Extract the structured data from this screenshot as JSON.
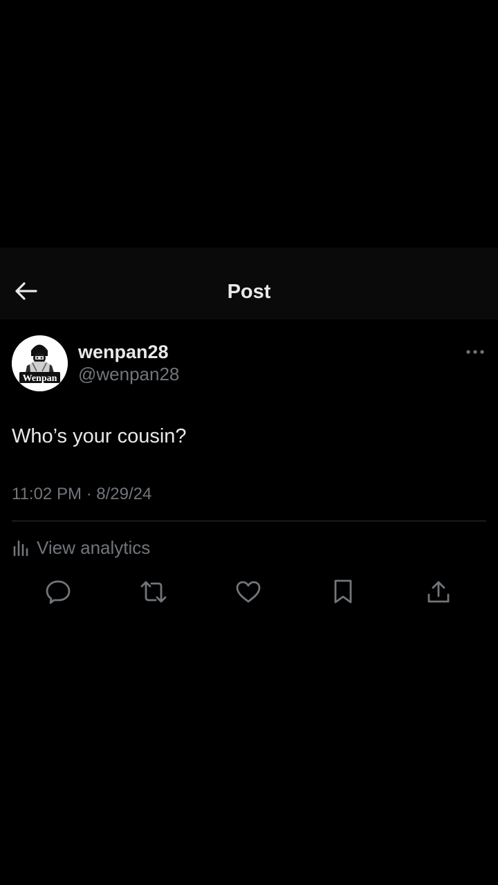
{
  "header": {
    "title": "Post",
    "back_icon": "arrow-left-icon"
  },
  "author": {
    "display_name": "wenpan28",
    "handle": "@wenpan28",
    "avatar_text": "Wenpan"
  },
  "post": {
    "text": "Who’s your cousin?",
    "timestamp": "11:02 PM · 8/29/24"
  },
  "analytics": {
    "label": "View analytics",
    "icon": "bar-chart-icon"
  },
  "actions": [
    {
      "name": "reply",
      "icon": "speech-bubble-icon"
    },
    {
      "name": "repost",
      "icon": "repost-arrows-icon"
    },
    {
      "name": "like",
      "icon": "heart-icon"
    },
    {
      "name": "bookmark",
      "icon": "bookmark-icon"
    },
    {
      "name": "share",
      "icon": "share-upload-icon"
    }
  ],
  "colors": {
    "background": "#000000",
    "header_background": "#0a0a0a",
    "primary_text": "#e7e9ea",
    "secondary_text": "#71767b",
    "divider": "#2f3336"
  }
}
